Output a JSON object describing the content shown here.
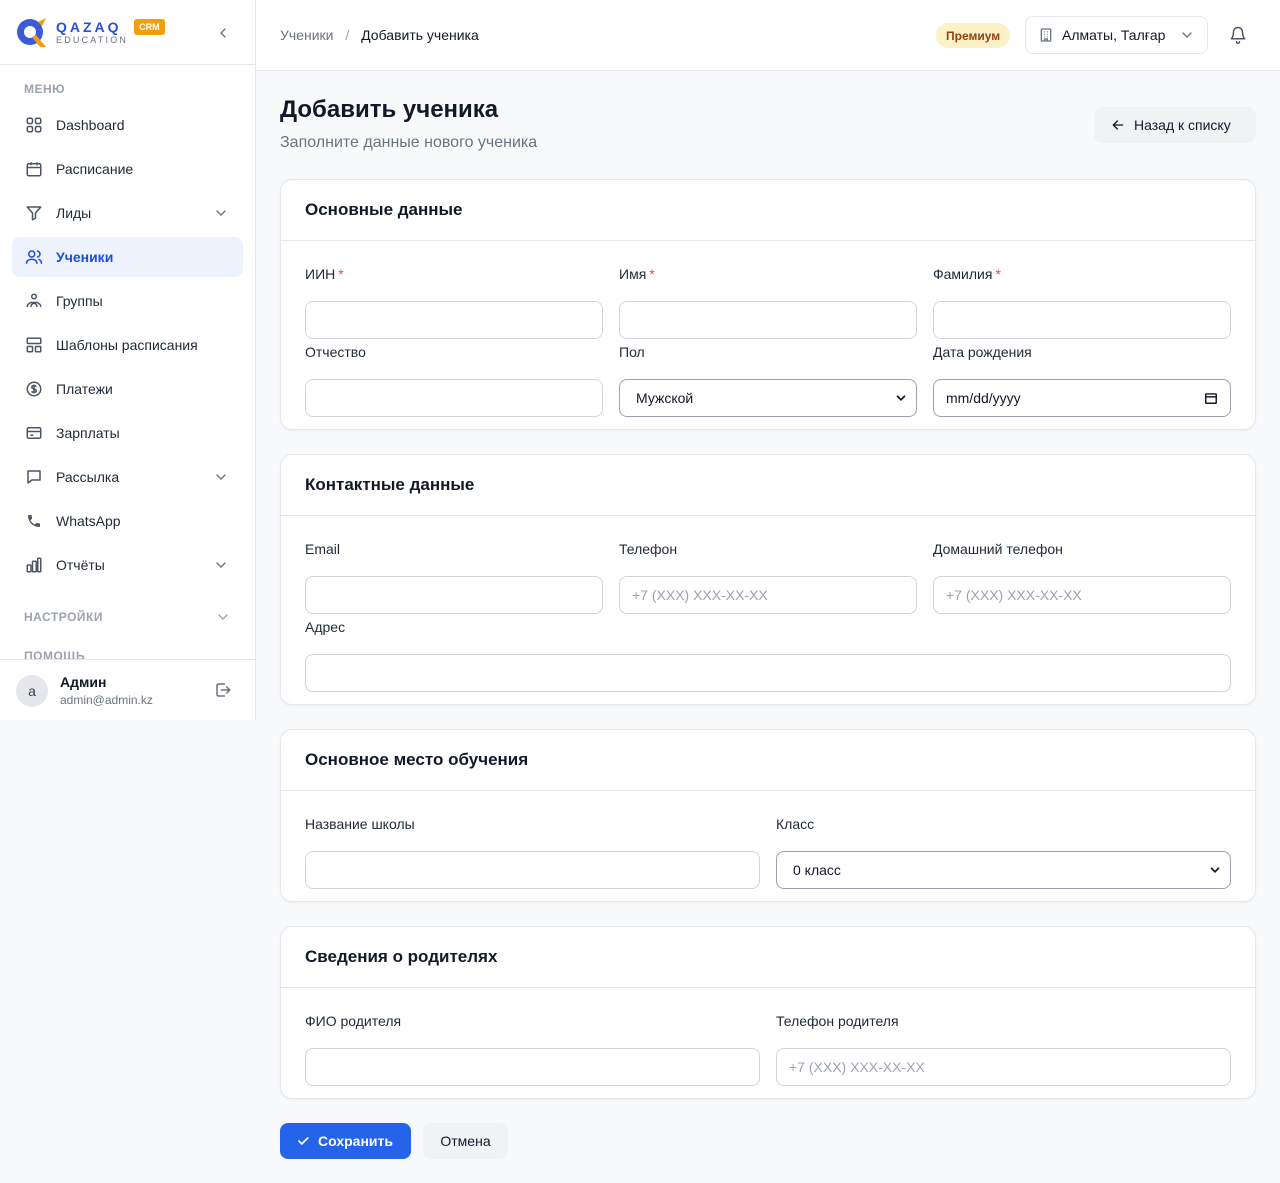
{
  "brand": {
    "title": "QAZAQ",
    "subtitle": "EDUCATION",
    "badge": "CRM"
  },
  "sidebar": {
    "menu_label": "МЕНЮ",
    "items": [
      {
        "label": "Dashboard",
        "icon": "grid-icon"
      },
      {
        "label": "Расписание",
        "icon": "calendar-icon"
      },
      {
        "label": "Лиды",
        "icon": "funnel-icon",
        "expandable": true
      },
      {
        "label": "Ученики",
        "icon": "users-icon",
        "active": true
      },
      {
        "label": "Группы",
        "icon": "group-icon"
      },
      {
        "label": "Шаблоны расписания",
        "icon": "template-icon"
      },
      {
        "label": "Платежи",
        "icon": "dollar-icon"
      },
      {
        "label": "Зарплаты",
        "icon": "card-icon"
      },
      {
        "label": "Рассылка",
        "icon": "chat-icon",
        "expandable": true
      },
      {
        "label": "WhatsApp",
        "icon": "phone-icon"
      },
      {
        "label": "Отчёты",
        "icon": "chart-icon",
        "expandable": true
      }
    ],
    "settings_label": "НАСТРОЙКИ",
    "help_label": "ПОМОЩЬ"
  },
  "user": {
    "initial": "a",
    "name": "Админ",
    "email": "admin@admin.kz"
  },
  "header": {
    "breadcrumb": {
      "parent": "Ученики",
      "separator": "/",
      "current": "Добавить ученика"
    },
    "plan_badge": "Премиум",
    "branch": "Алматы, Талғар"
  },
  "page": {
    "title": "Добавить ученика",
    "subtitle": "Заполните данные нового ученика",
    "back_label": "Назад к списку"
  },
  "sections": {
    "basic": {
      "title": "Основные данные",
      "iin": {
        "label": "ИИН",
        "value": ""
      },
      "first_name": {
        "label": "Имя",
        "value": ""
      },
      "last_name": {
        "label": "Фамилия",
        "value": ""
      },
      "patronymic": {
        "label": "Отчество",
        "value": ""
      },
      "gender": {
        "label": "Пол",
        "value": "Мужской"
      },
      "birthdate": {
        "label": "Дата рождения",
        "placeholder": "mm/dd/yyyy"
      }
    },
    "contact": {
      "title": "Контактные данные",
      "email": {
        "label": "Email",
        "value": ""
      },
      "phone": {
        "label": "Телефон",
        "placeholder": "+7 (XXX) XXX-XX-XX"
      },
      "home_phone": {
        "label": "Домашний телефон",
        "placeholder": "+7 (XXX) XXX-XX-XX"
      },
      "address": {
        "label": "Адрес",
        "value": ""
      }
    },
    "school": {
      "title": "Основное место обучения",
      "school_name": {
        "label": "Название школы",
        "value": ""
      },
      "grade": {
        "label": "Класс",
        "value": "0 класс"
      }
    },
    "parents": {
      "title": "Сведения о родителях",
      "parent_name": {
        "label": "ФИО родителя",
        "value": ""
      },
      "parent_phone": {
        "label": "Телефон родителя",
        "placeholder": "+7 (XXX) XXX-XX-XX"
      }
    }
  },
  "required_mark": "*",
  "actions": {
    "save": "Сохранить",
    "cancel": "Отмена"
  },
  "colors": {
    "primary": "#2563eb",
    "accent": "#f59e0b",
    "active_bg": "#eef2fd",
    "required": "#ef4444"
  }
}
